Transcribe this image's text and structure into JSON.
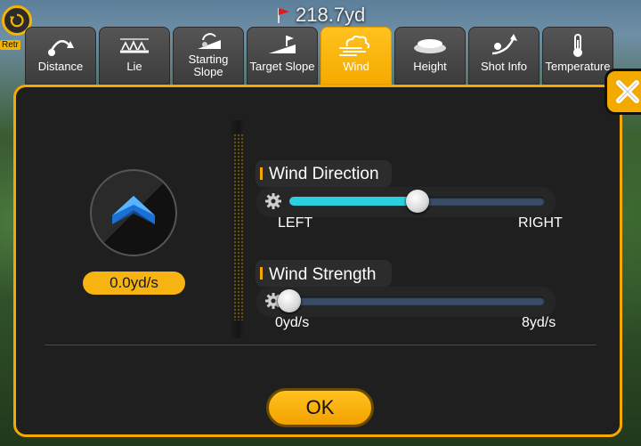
{
  "hud": {
    "retry_label": "Retr",
    "distance": "218.7yd"
  },
  "tabs": [
    {
      "label": "Distance",
      "icon": "distance-icon",
      "active": false
    },
    {
      "label": "Lie",
      "icon": "lie-icon",
      "active": false
    },
    {
      "label": "Starting Slope",
      "icon": "starting-slope-icon",
      "active": false
    },
    {
      "label": "Target Slope",
      "icon": "target-slope-icon",
      "active": false
    },
    {
      "label": "Wind",
      "icon": "wind-icon",
      "active": true
    },
    {
      "label": "Height",
      "icon": "height-icon",
      "active": false
    },
    {
      "label": "Shot Info",
      "icon": "shot-info-icon",
      "active": false
    },
    {
      "label": "Temperature",
      "icon": "thermometer-icon",
      "active": false
    }
  ],
  "wind": {
    "value_display": "0.0yd/s",
    "direction": {
      "title": "Wind Direction",
      "min_label": "LEFT",
      "max_label": "RIGHT",
      "position_fraction": 0.5
    },
    "strength": {
      "title": "Wind Strength",
      "min_label": "0yd/s",
      "max_label": "8yd/s",
      "position_fraction": 0.0
    }
  },
  "ok_label": "OK",
  "colors": {
    "accent": "#f4a800",
    "slider_fill": "#2ccfe0",
    "panel_bg": "#1f1f1f",
    "arrow": "#1e7fe6"
  }
}
